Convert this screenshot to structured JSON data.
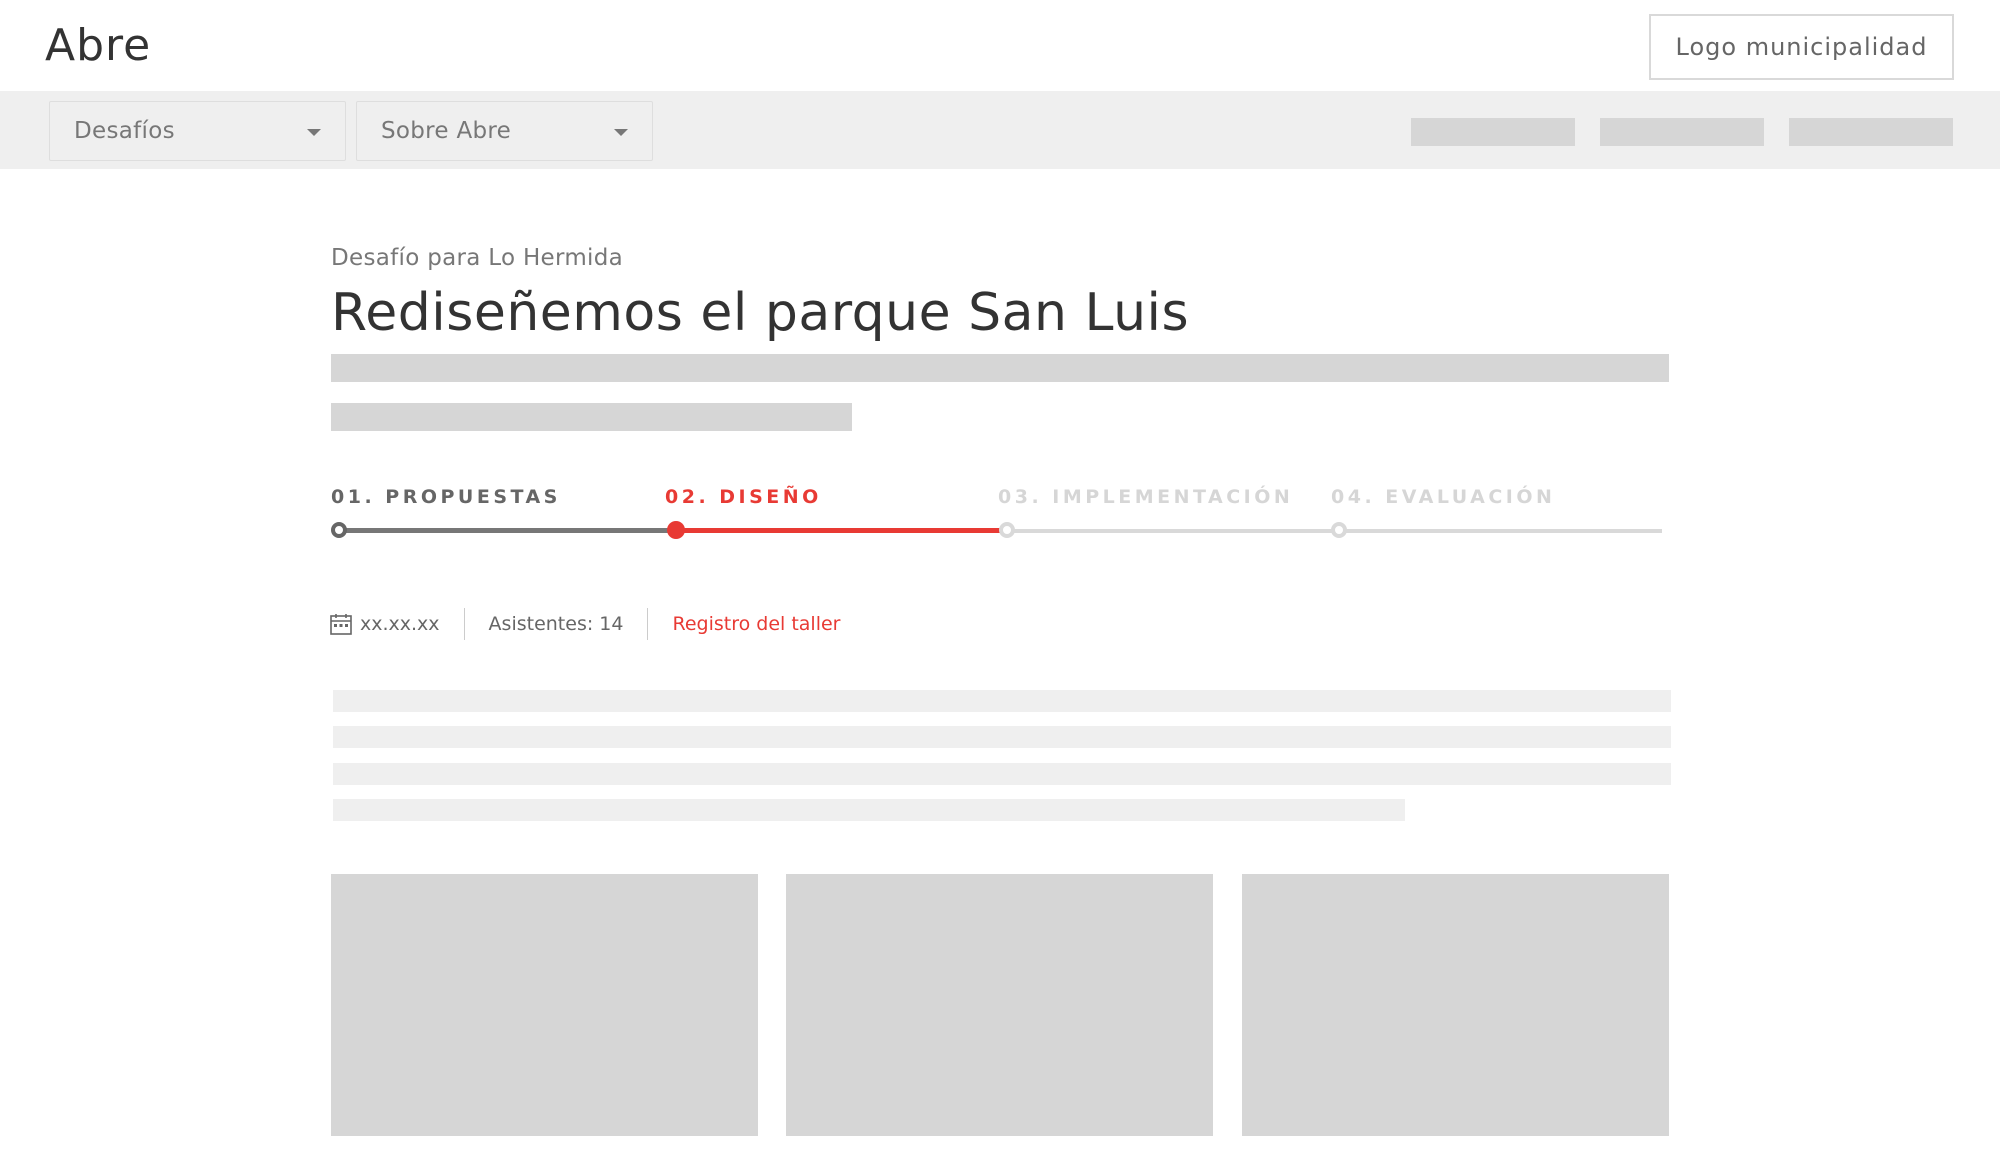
{
  "header": {
    "brand": "Abre",
    "logo_placeholder": "Logo municipalidad"
  },
  "nav": {
    "dropdowns": [
      {
        "label": "Desafíos",
        "icon": "caret-down-icon"
      },
      {
        "label": "Sobre Abre",
        "icon": "caret-down-icon"
      }
    ],
    "placeholder_items": 3
  },
  "challenge": {
    "eyebrow": "Desafío para Lo Hermida",
    "title": "Rediseñemos el parque San Luis"
  },
  "stepper": {
    "current_step": 2,
    "steps": [
      {
        "label": "01. PROPUESTAS",
        "state": "done"
      },
      {
        "label": "02. DISEÑO",
        "state": "active"
      },
      {
        "label": "03. IMPLEMENTACIÓN",
        "state": "todo"
      },
      {
        "label": "04. EVALUACIÓN",
        "state": "todo"
      }
    ]
  },
  "meta": {
    "date_icon": "calendar-icon",
    "date": "xx.xx.xx",
    "attendees": "Asistentes: 14",
    "register_link": "Registro del taller"
  },
  "colors": {
    "accent": "#e83a34",
    "navbar_bg": "#efefef",
    "placeholder": "#d6d6d6",
    "text_dark": "#333333",
    "text_muted": "#777777"
  }
}
